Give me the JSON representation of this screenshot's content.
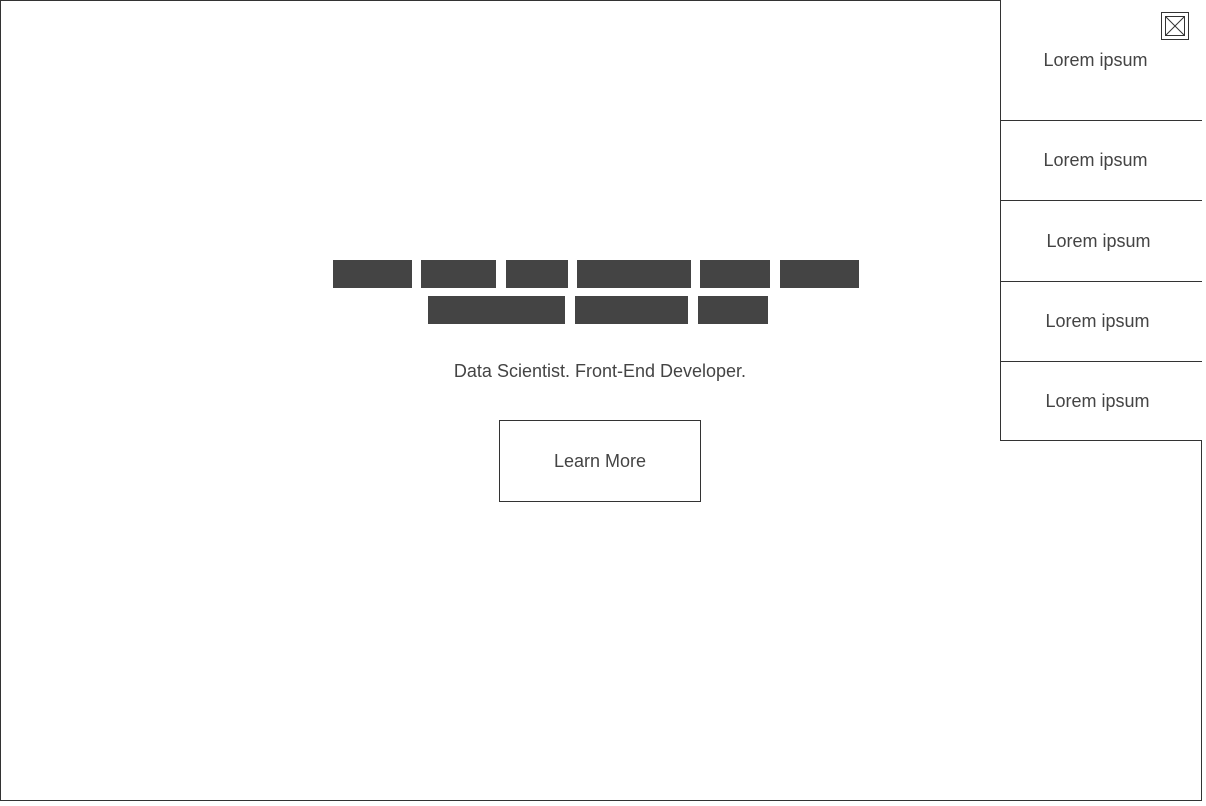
{
  "hero": {
    "tagline": "Data Scientist. Front-End Developer.",
    "cta_label": "Learn More",
    "heading_placeholder_color": "#444444"
  },
  "side_menu": {
    "close_icon": "image-placeholder-close-icon",
    "items": [
      {
        "label": "Lorem ipsum"
      },
      {
        "label": "Lorem ipsum"
      },
      {
        "label": "Lorem ipsum"
      },
      {
        "label": "Lorem ipsum"
      },
      {
        "label": "Lorem ipsum"
      }
    ]
  }
}
